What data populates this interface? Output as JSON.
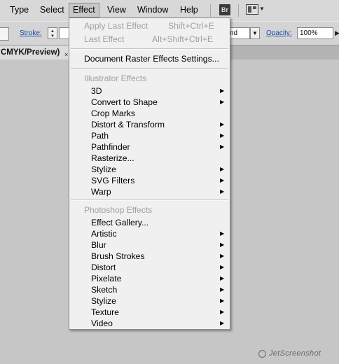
{
  "menubar": {
    "items": [
      "Type",
      "Select",
      "Effect",
      "View",
      "Window",
      "Help"
    ],
    "active": "Effect",
    "bridge_label": "Br"
  },
  "controlbar": {
    "stroke_label": "Stroke:",
    "blend_value": "nd",
    "opacity_label": "Opacity:",
    "opacity_value": "100%"
  },
  "document": {
    "tab_label": "CMYK/Preview)",
    "close_glyph": "×"
  },
  "effect_menu": {
    "apply_last": {
      "label": "Apply Last Effect",
      "shortcut": "Shift+Ctrl+E"
    },
    "last": {
      "label": "Last Effect",
      "shortcut": "Alt+Shift+Ctrl+E"
    },
    "raster_settings": "Document Raster Effects Settings...",
    "illustrator_header": "Illustrator Effects",
    "illustrator_items": [
      "3D",
      "Convert to Shape",
      "Crop Marks",
      "Distort & Transform",
      "Path",
      "Pathfinder",
      "Rasterize...",
      "Stylize",
      "SVG Filters",
      "Warp"
    ],
    "photoshop_header": "Photoshop Effects",
    "photoshop_items": [
      "Effect Gallery...",
      "Artistic",
      "Blur",
      "Brush Strokes",
      "Distort",
      "Pixelate",
      "Sketch",
      "Stylize",
      "Texture",
      "Video"
    ],
    "submenu_arrow": "▶"
  },
  "watermark": "JetScreenshot"
}
